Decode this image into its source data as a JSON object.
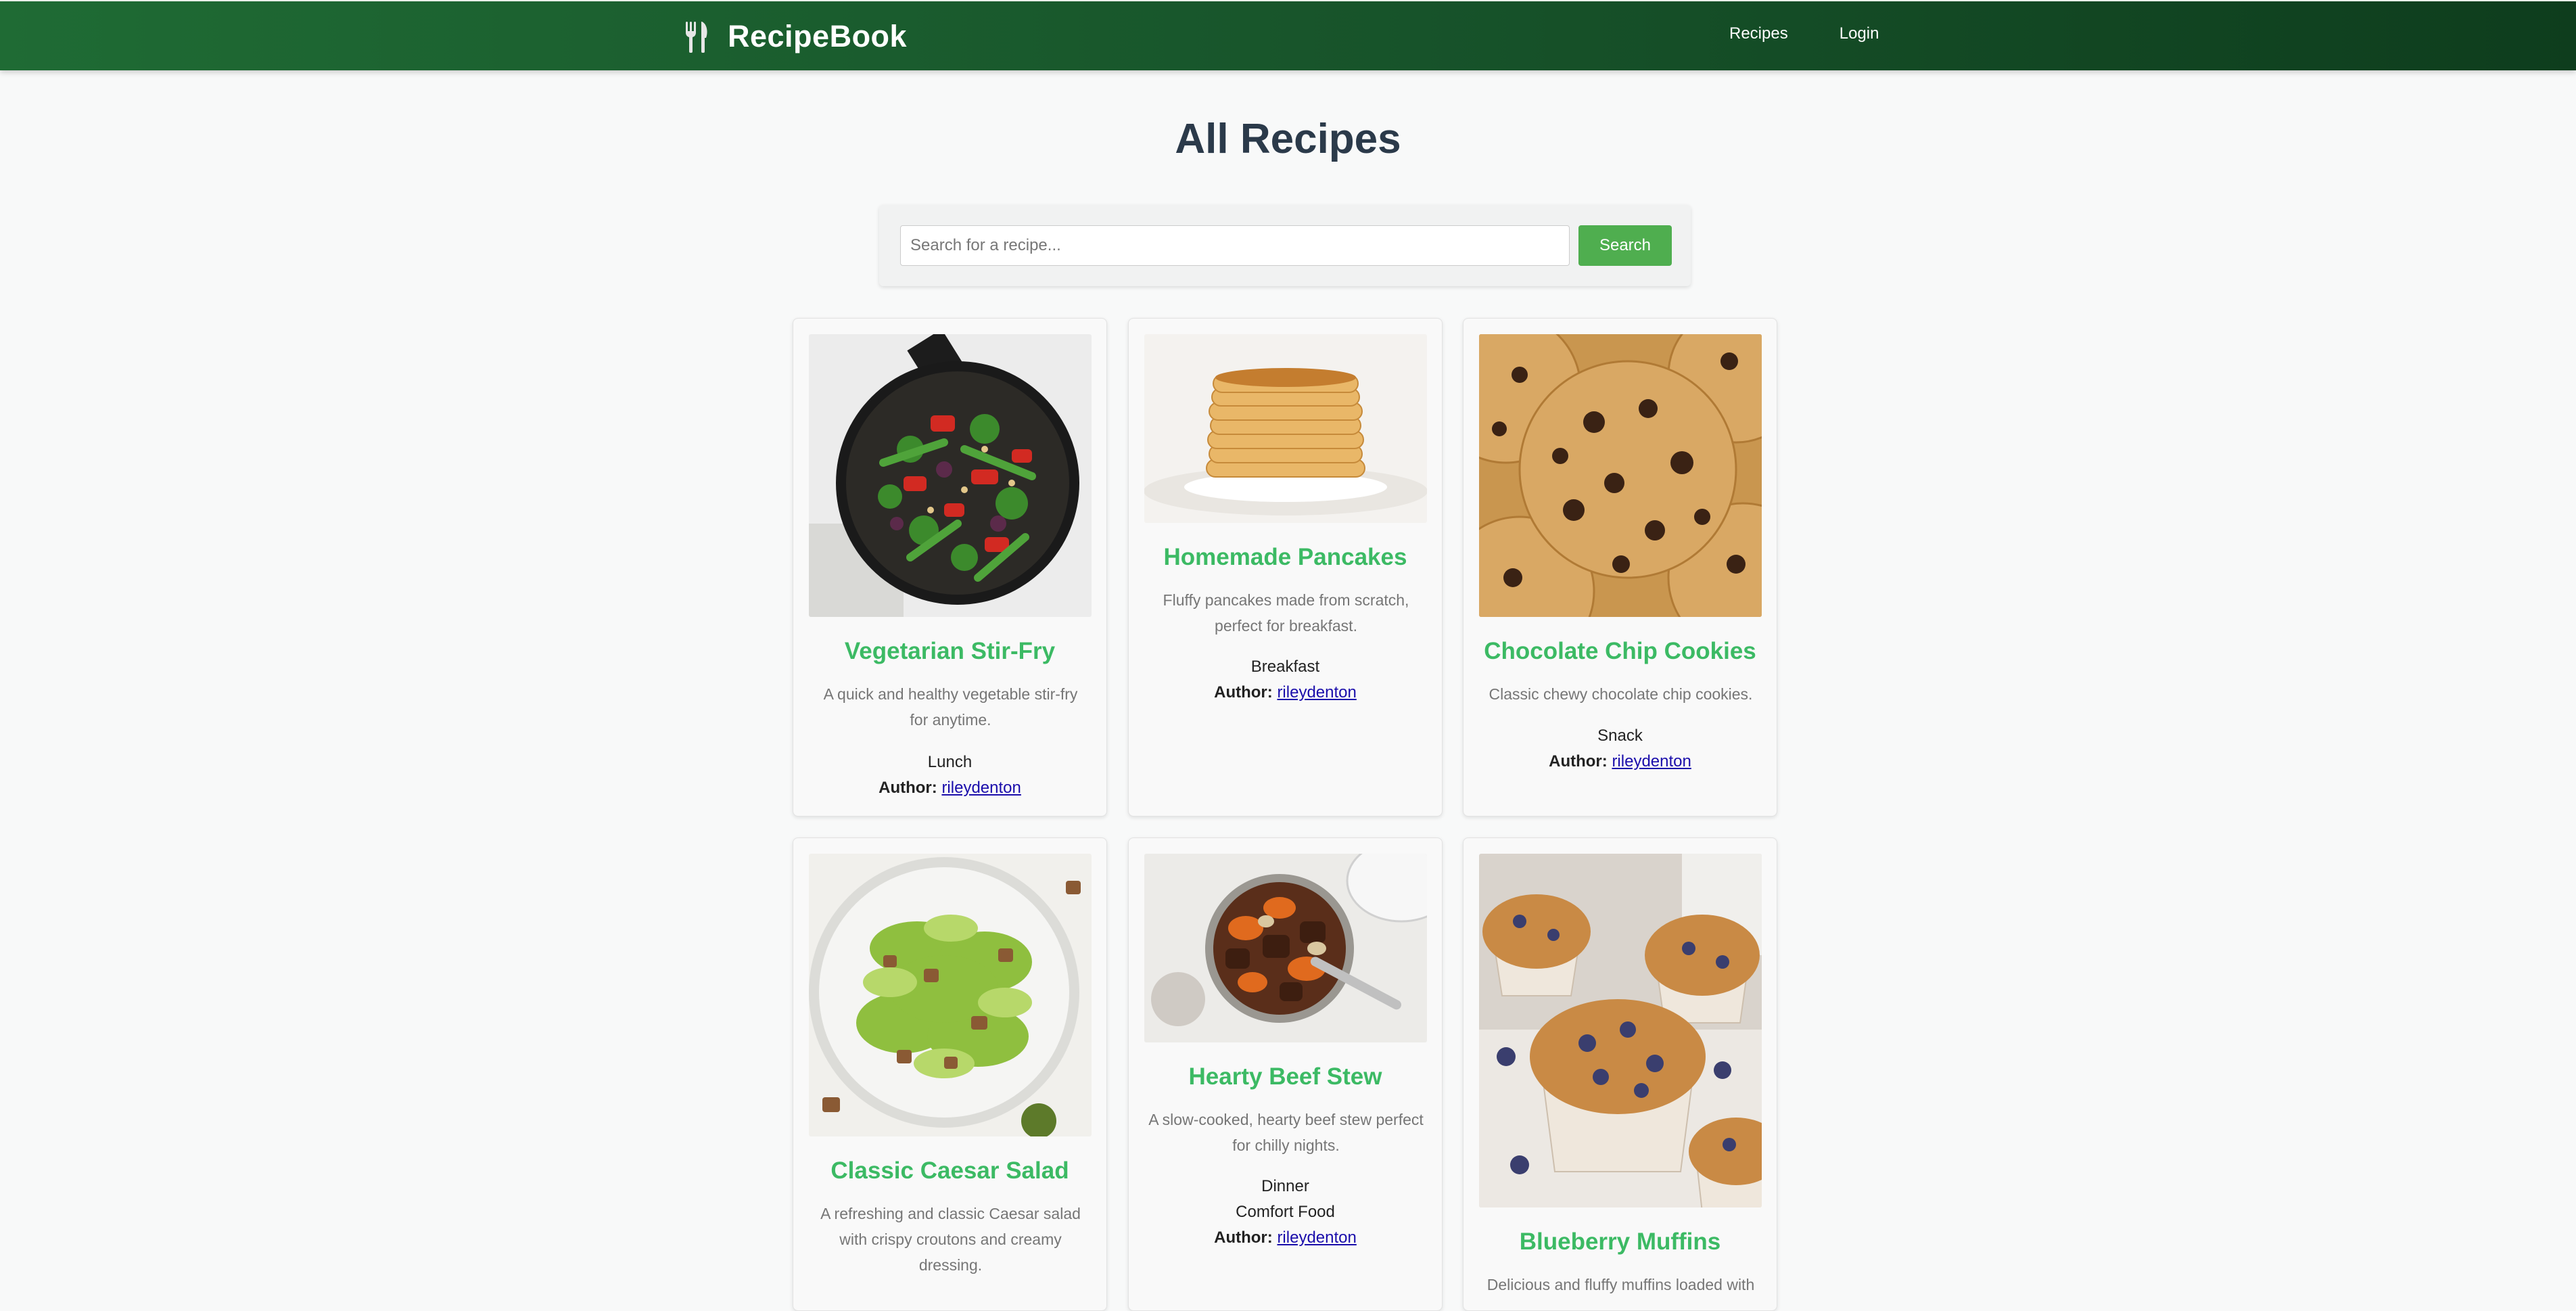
{
  "header": {
    "brand": "RecipeBook",
    "brand_icon": "fork-knife-icon",
    "nav": [
      "Recipes",
      "Login"
    ]
  },
  "page_title": "All Recipes",
  "search": {
    "placeholder": "Search for a recipe...",
    "button": "Search"
  },
  "author_label": "Author:",
  "recipes": [
    {
      "title": "Vegetarian Stir-Fry",
      "description": "A quick and healthy vegetable stir-fry for anytime.",
      "categories": [
        "Lunch"
      ],
      "author": "rileydenton",
      "image": "vegetable-stir-fry-photo"
    },
    {
      "title": "Homemade Pancakes",
      "description": "Fluffy pancakes made from scratch, perfect for breakfast.",
      "categories": [
        "Breakfast"
      ],
      "author": "rileydenton",
      "image": "pancake-stack-photo"
    },
    {
      "title": "Chocolate Chip Cookies",
      "description": "Classic chewy chocolate chip cookies.",
      "categories": [
        "Snack"
      ],
      "author": "rileydenton",
      "image": "cookies-photo"
    },
    {
      "title": "Classic Caesar Salad",
      "description": "A refreshing and classic Caesar salad with crispy croutons and creamy dressing.",
      "categories": [],
      "author": "",
      "image": "caesar-salad-photo"
    },
    {
      "title": "Hearty Beef Stew",
      "description": "A slow-cooked, hearty beef stew perfect for chilly nights.",
      "categories": [
        "Dinner",
        "Comfort Food"
      ],
      "author": "rileydenton",
      "image": "beef-stew-photo"
    },
    {
      "title": "Blueberry Muffins",
      "description": "Delicious and fluffy muffins loaded with",
      "categories": [],
      "author": "",
      "image": "blueberry-muffins-photo"
    }
  ],
  "colors": {
    "header": "#17532a",
    "accent": "#3cba64",
    "button": "#4fae4f",
    "link": "#1a0dab"
  }
}
